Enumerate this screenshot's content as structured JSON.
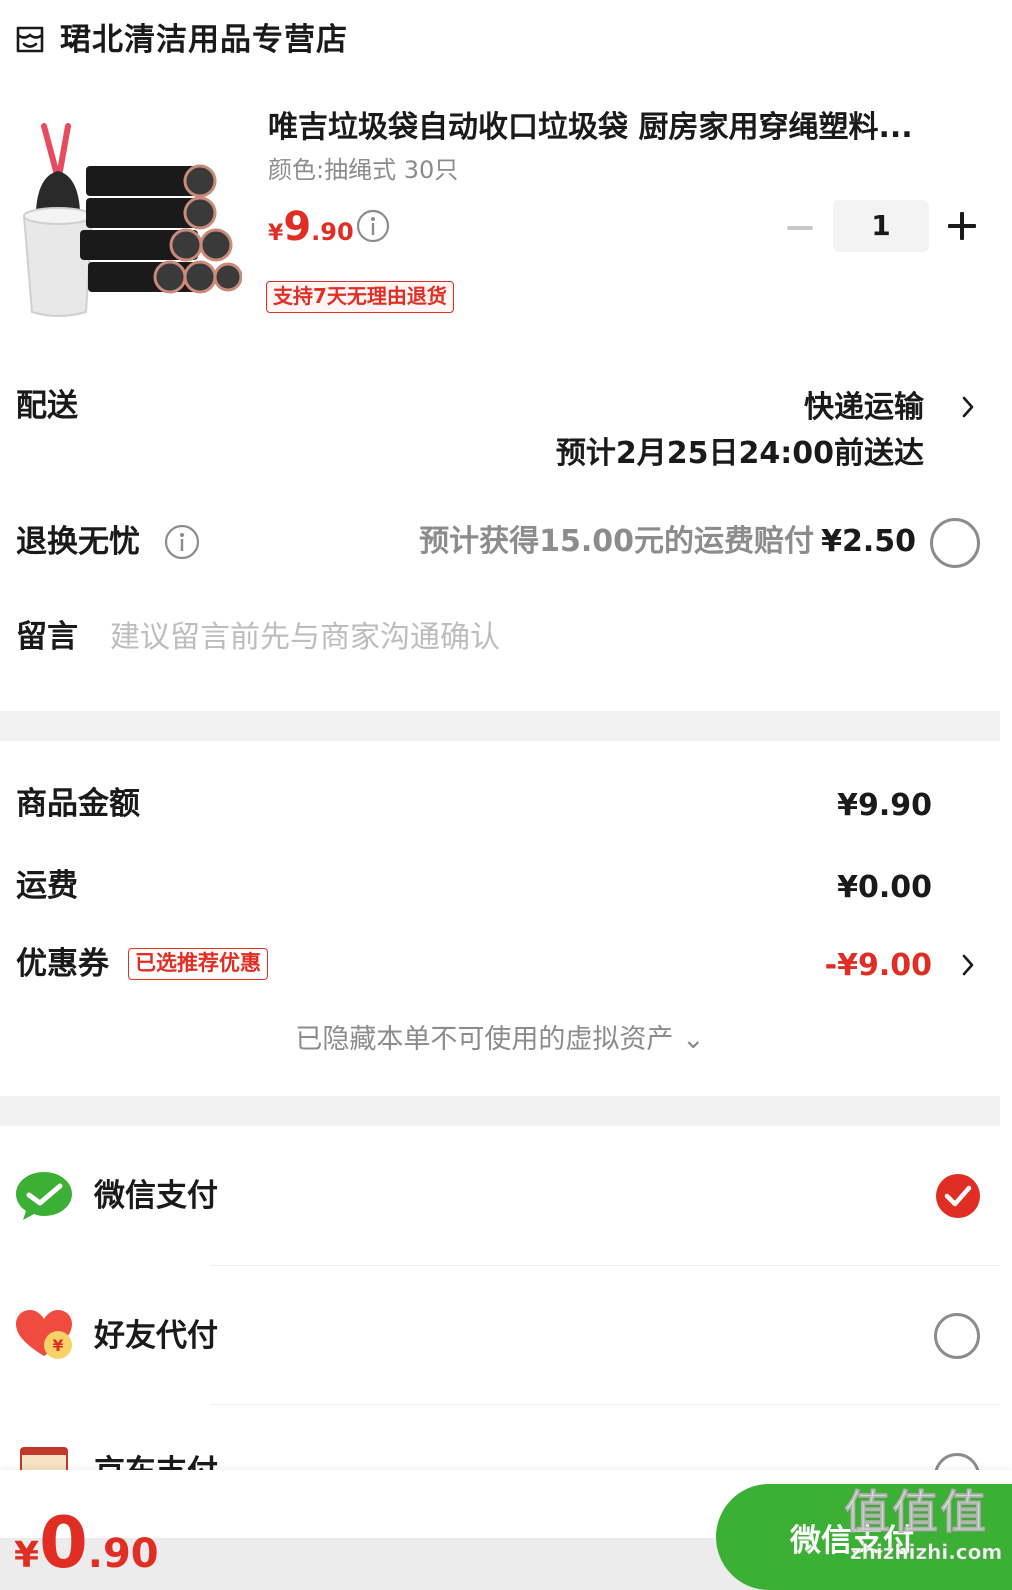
{
  "store": {
    "name": "珺北清洁用品专营店"
  },
  "product": {
    "title": "唯吉垃圾袋自动收口垃圾袋 厨房家用穿绳塑料...",
    "spec": "颜色:抽绳式 30只",
    "price": {
      "currency": "¥",
      "integer": "9",
      "decimal": ".90"
    },
    "quantity": "1",
    "return_tag": "支持7天无理由退货"
  },
  "delivery": {
    "label": "配送",
    "method": "快递运输",
    "eta": "预计2月25日24:00前送达"
  },
  "return_insurance": {
    "label": "退换无忧",
    "description": "预计获得15.00元的运费赔付",
    "price": "¥2.50",
    "selected": false
  },
  "message": {
    "label": "留言",
    "placeholder": "建议留言前先与商家沟通确认"
  },
  "summary": {
    "goods_label": "商品金额",
    "goods_value": "¥9.90",
    "shipping_label": "运费",
    "shipping_value": "¥0.00",
    "coupon_label": "优惠券",
    "coupon_tag": "已选推荐优惠",
    "coupon_value": "-¥9.00",
    "hidden_assets": "已隐藏本单不可使用的虚拟资产 ⌄"
  },
  "payment": {
    "methods": [
      {
        "label": "微信支付",
        "icon": "wechat-pay-icon",
        "selected": true
      },
      {
        "label": "好友代付",
        "icon": "friend-pay-icon",
        "selected": false
      },
      {
        "label": "京东支付",
        "icon": "card-pay-icon",
        "selected": false
      }
    ]
  },
  "footer": {
    "total": {
      "currency": "¥",
      "integer": "0",
      "decimal": ".90"
    },
    "pay_button": "微信支付",
    "watermark": "值值值",
    "watermark_sub": "zhizhizhi.com"
  },
  "colors": {
    "accent_red": "#e02e24",
    "wechat_green": "#3cb034",
    "muted_gray": "#8c8c8c",
    "section_gap": "#f2f2f2"
  }
}
